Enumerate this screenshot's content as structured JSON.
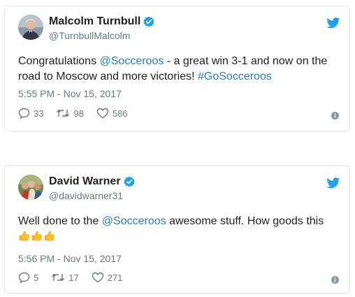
{
  "tweets": [
    {
      "name": "Malcolm Turnbull",
      "handle": "@TurnbullMalcolm",
      "text_parts": {
        "p1": "Congratulations ",
        "mention": "@Socceroos",
        "p2": " - a great win 3-1 and now on the road to Moscow and more victories! ",
        "hashtag": "#GoSocceroos"
      },
      "timestamp": "5:55 PM - Nov 15, 2017",
      "replies": "33",
      "retweets": "98",
      "likes": "586",
      "verified": true
    },
    {
      "name": "David Warner",
      "handle": "@davidwarner31",
      "text_parts": {
        "p1": "Well done to the ",
        "mention": "@Socceroos",
        "p2": " awesome stuff. How goods this"
      },
      "emoji": [
        "thumbs-up",
        "thumbs-up",
        "thumbs-up"
      ],
      "timestamp": "5:56 PM - Nov 15, 2017",
      "replies": "5",
      "retweets": "17",
      "likes": "271",
      "verified": true
    }
  ],
  "colors": {
    "link": "#2b7bb9",
    "muted": "#697882",
    "verified": "#1da1f2",
    "twitter_blue": "#1da1f2",
    "border": "#e1e8ed"
  },
  "icons": [
    "verified-badge-icon",
    "twitter-bird-icon",
    "reply-icon",
    "retweet-icon",
    "like-icon",
    "info-icon",
    "thumbs-up-emoji"
  ]
}
